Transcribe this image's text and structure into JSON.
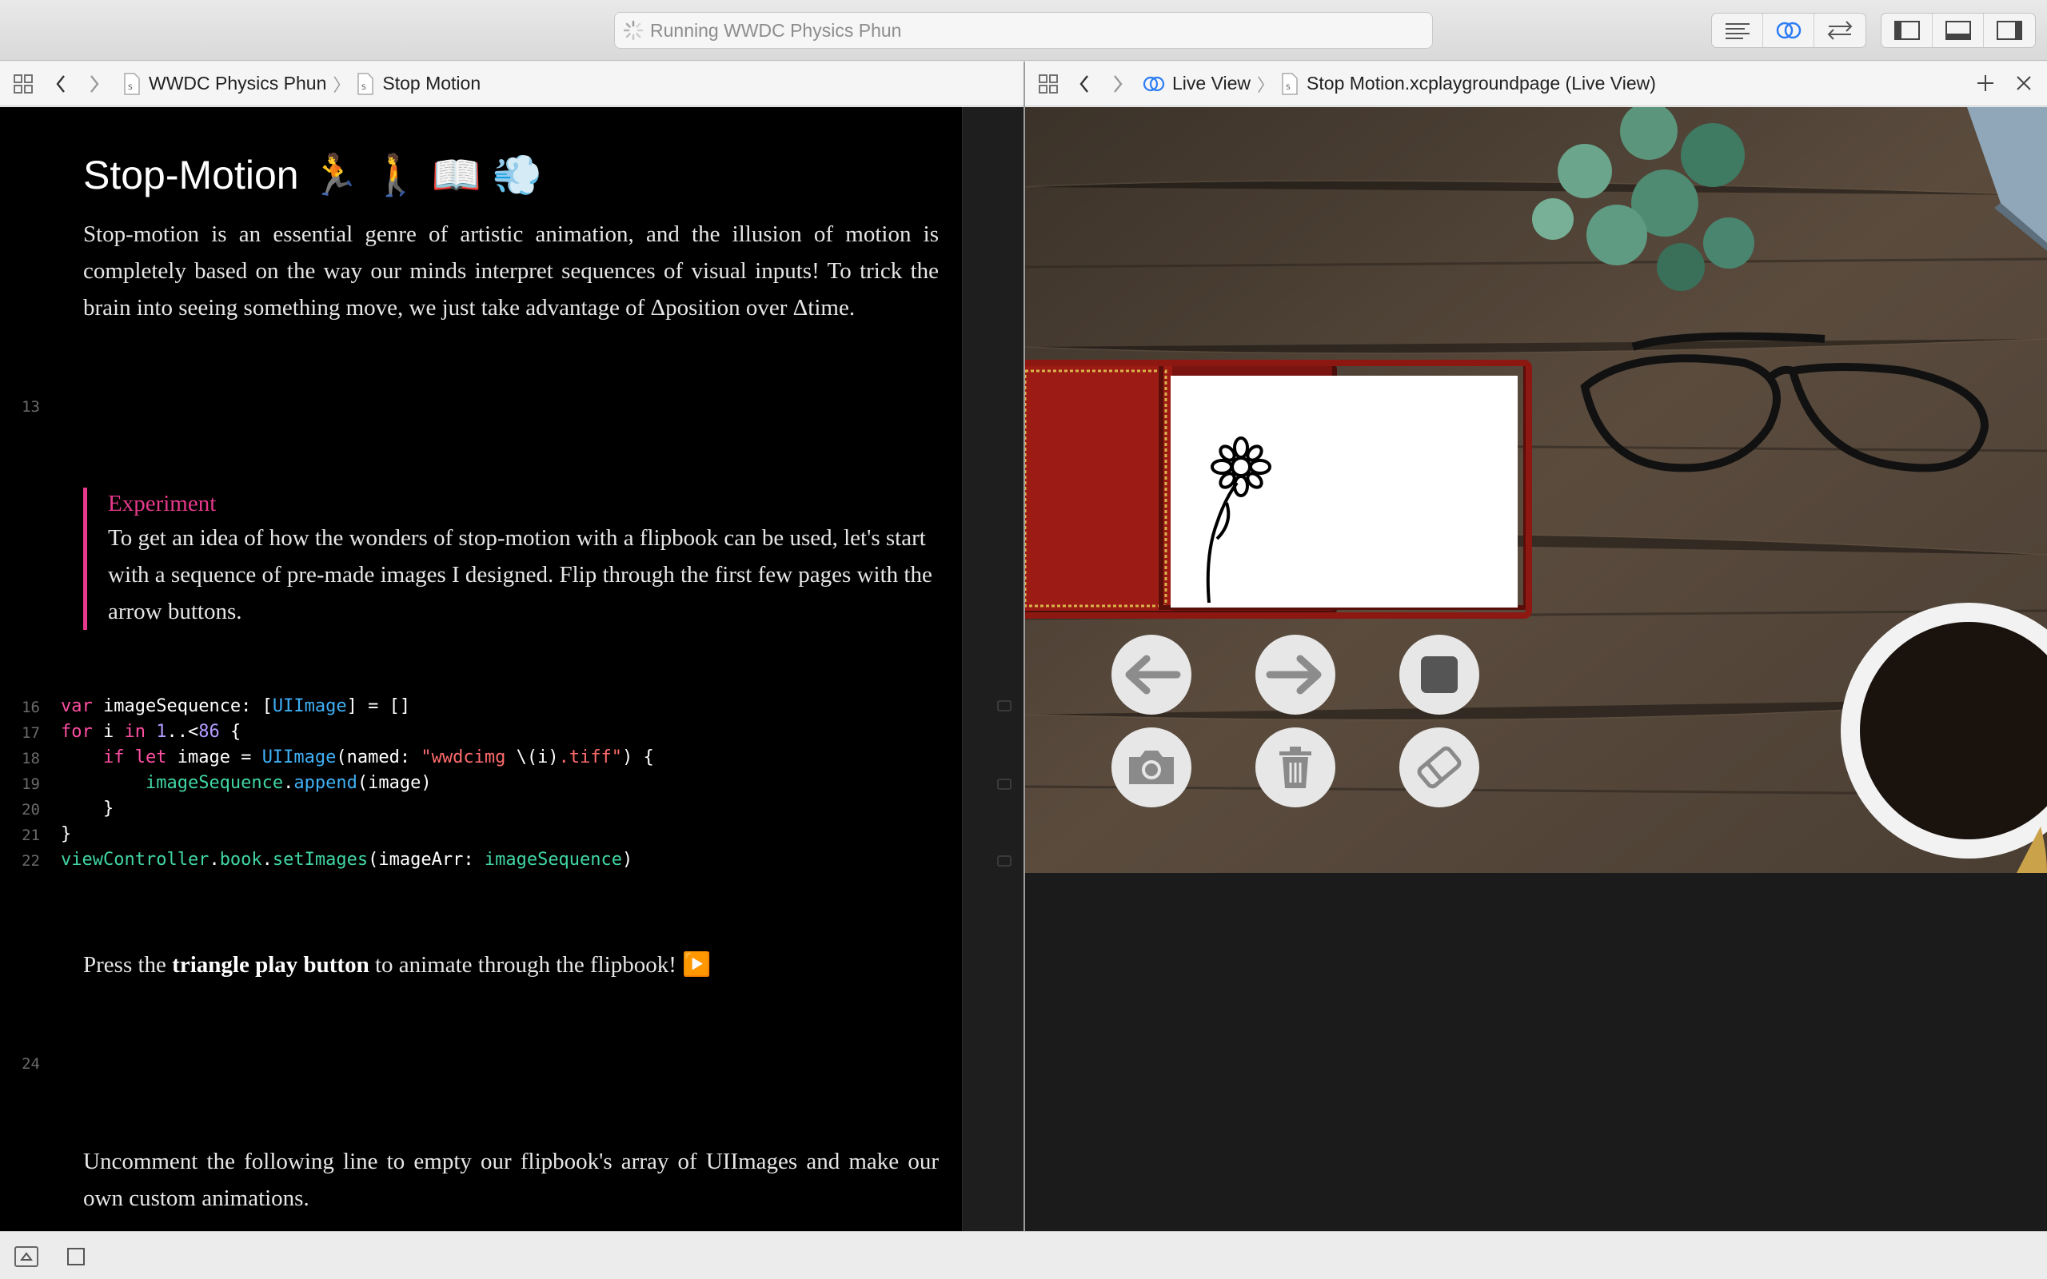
{
  "toolbar": {
    "activity_text": "Running WWDC Physics Phun"
  },
  "left_jumpbar": {
    "crumbs": [
      "WWDC Physics Phun",
      "Stop Motion"
    ]
  },
  "right_jumpbar": {
    "crumbs": [
      "Live View",
      "Stop Motion.xcplaygroundpage (Live View)"
    ]
  },
  "editor": {
    "title": "Stop-Motion 🏃 🚶 📖 💨",
    "intro": "Stop-motion is an essential genre of artistic animation, and the illusion of motion is completely based on the way our minds interpret sequences of visual inputs! To trick the brain into seeing something move, we just take advantage of Δposition over Δtime.",
    "line_13": "13",
    "callout_head": "Experiment",
    "callout_body": "To get an idea of how the wonders of stop-motion with a flipbook can be used, let's start with a sequence of pre-made images I designed. Flip through the first few pages with the arrow buttons.",
    "code_lines": [
      {
        "no": "16",
        "text": "var imageSequence: [UIImage] = []"
      },
      {
        "no": "17",
        "text": "for i in 1..<86 {"
      },
      {
        "no": "18",
        "text": "    if let image = UIImage(named: \"wwdcimg \\(i).tiff\") {"
      },
      {
        "no": "19",
        "text": "        imageSequence.append(image)"
      },
      {
        "no": "20",
        "text": "    }"
      },
      {
        "no": "21",
        "text": "}"
      },
      {
        "no": "22",
        "text": "viewController.book.setImages(imageArr: imageSequence)"
      }
    ],
    "press_pre": "Press the ",
    "press_bold": "triangle play button",
    "press_post": " to animate through the flipbook! ▶️",
    "line_24": "24",
    "uncomment": "Uncomment the following line to empty our flipbook's array of UIImages and make our own custom animations."
  },
  "live_view": {
    "buttons": [
      "back-arrow",
      "forward-arrow",
      "stop",
      "camera",
      "trash",
      "eraser"
    ]
  },
  "colors": {
    "keyword": "#ff4fa3",
    "type": "#3fb1f5",
    "function": "#41d6a4",
    "string": "#ff6b6b",
    "number": "#b39cff",
    "callout_accent": "#e6398b"
  }
}
